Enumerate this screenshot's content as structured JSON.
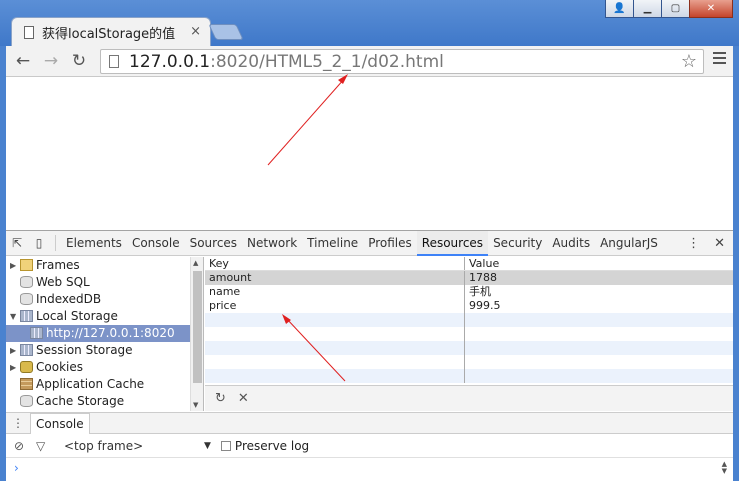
{
  "window": {
    "minimize": "▁",
    "maximize": "▢",
    "close": "✕"
  },
  "tab": {
    "title": "获得localStorage的值",
    "close": "×"
  },
  "toolbar": {
    "back": "←",
    "forward": "→",
    "reload": "↻",
    "url_host": "127.0.0.1",
    "url_rest": ":8020/HTML5_2_1/d02.html",
    "star": "☆"
  },
  "devtools": {
    "tabs": [
      "Elements",
      "Console",
      "Sources",
      "Network",
      "Timeline",
      "Profiles",
      "Resources",
      "Security",
      "Audits",
      "AngularJS"
    ],
    "active_tab": "Resources",
    "sidebar": [
      {
        "label": "Frames",
        "icon": "folder-icon",
        "arrow": "▶"
      },
      {
        "label": "Web SQL",
        "icon": "database-icon",
        "arrow": ""
      },
      {
        "label": "IndexedDB",
        "icon": "database-icon",
        "arrow": ""
      },
      {
        "label": "Local Storage",
        "icon": "storage-grid-icon",
        "arrow": "▼"
      },
      {
        "label": "http://127.0.0.1:8020",
        "icon": "storage-grid-icon",
        "arrow": "",
        "selected": true
      },
      {
        "label": "Session Storage",
        "icon": "storage-grid-icon",
        "arrow": "▶"
      },
      {
        "label": "Cookies",
        "icon": "cookie-icon",
        "arrow": "▶"
      },
      {
        "label": "Application Cache",
        "icon": "app-cache-icon",
        "arrow": ""
      },
      {
        "label": "Cache Storage",
        "icon": "database-icon",
        "arrow": ""
      }
    ],
    "grid": {
      "headers": {
        "key": "Key",
        "value": "Value"
      },
      "rows": [
        {
          "key": "amount",
          "value": "1788"
        },
        {
          "key": "name",
          "value": "手机"
        },
        {
          "key": "price",
          "value": "999.5"
        }
      ]
    },
    "footer": {
      "refresh": "↻",
      "delete": "✕"
    },
    "drawer": {
      "tab": "Console",
      "frame": "<top frame>",
      "preserve_log": "Preserve log",
      "prompt": "›"
    }
  },
  "colors": {
    "accent": "#3e82f7",
    "frame": "#3f78c9",
    "annotation": "#e02020"
  }
}
